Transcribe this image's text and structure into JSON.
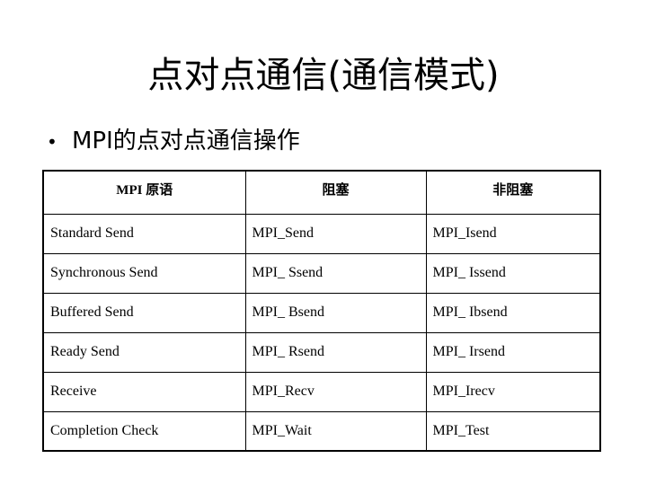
{
  "slide": {
    "title": "点对点通信(通信模式)",
    "bullet": {
      "marker": "bullet-dot",
      "text": "MPI的点对点通信操作"
    }
  },
  "table": {
    "headers": [
      "MPI 原语",
      "阻塞",
      "非阻塞"
    ],
    "rows": [
      {
        "primitive": "Standard Send",
        "blocking": "MPI_Send",
        "nonblocking": "MPI_Isend"
      },
      {
        "primitive": "Synchronous Send",
        "blocking": "MPI_ Ssend",
        "nonblocking": "MPI_ Issend"
      },
      {
        "primitive": "Buffered Send",
        "blocking": "MPI_ Bsend",
        "nonblocking": "MPI_ Ibsend"
      },
      {
        "primitive": "Ready Send",
        "blocking": "MPI_ Rsend",
        "nonblocking": "MPI_ Irsend"
      },
      {
        "primitive": "Receive",
        "blocking": "MPI_Recv",
        "nonblocking": "MPI_Irecv"
      },
      {
        "primitive": "Completion Check",
        "blocking": "MPI_Wait",
        "nonblocking": "MPI_Test"
      }
    ]
  },
  "colors": {
    "background": "#ffffff",
    "text": "#000000",
    "border": "#000000"
  }
}
